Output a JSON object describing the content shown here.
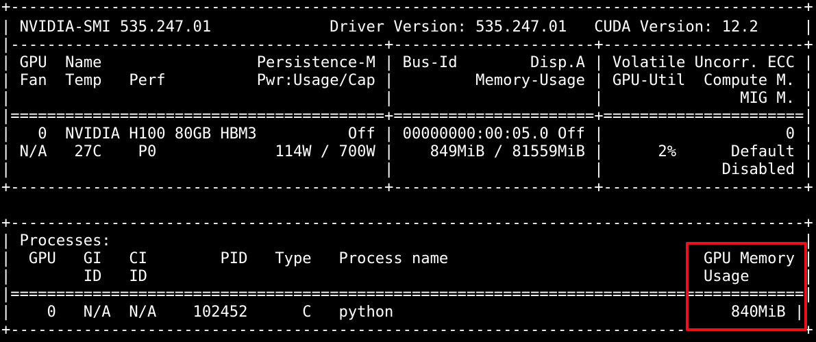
{
  "terminal": {
    "lines": [
      "+---------------------------------------------------------------------------------------+",
      "| NVIDIA-SMI 535.247.01             Driver Version: 535.247.01   CUDA Version: 12.2     |",
      "|-----------------------------------------+----------------------+----------------------+",
      "| GPU  Name                 Persistence-M | Bus-Id        Disp.A | Volatile Uncorr. ECC |",
      "| Fan  Temp   Perf          Pwr:Usage/Cap |         Memory-Usage | GPU-Util  Compute M. |",
      "|                                         |                      |               MIG M. |",
      "|=========================================+======================+======================|",
      "|   0  NVIDIA H100 80GB HBM3          Off | 00000000:00:05.0 Off |                    0 |",
      "| N/A   27C    P0             114W / 700W |    849MiB / 81559MiB |      2%      Default |",
      "|                                         |                      |             Disabled |",
      "+-----------------------------------------+----------------------+----------------------+",
      "",
      "+---------------------------------------------------------------------------------------+",
      "| Processes:                                                                            |",
      "|  GPU   GI   CI        PID   Type   Process name                            GPU Memory |",
      "|        ID   ID                                                             Usage      |",
      "|=======================================================================================|",
      "|    0   N/A  N/A    102452      C   python                                     840MiB |",
      "+---------------------------------------------------------------------------------------+"
    ]
  },
  "highlight": {
    "color": "#e8121a",
    "target": "GPU Memory Usage"
  }
}
